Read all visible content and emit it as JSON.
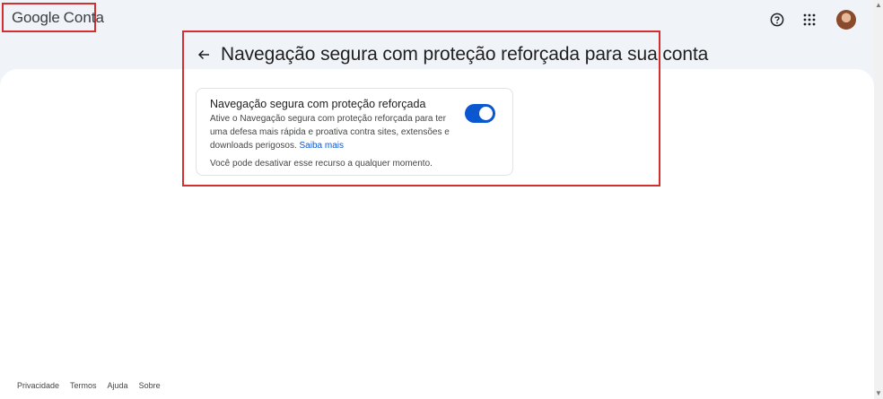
{
  "brand": {
    "google": "Google",
    "product": "Conta"
  },
  "header": {
    "icons": [
      "help-icon",
      "apps-grid-icon",
      "avatar"
    ]
  },
  "page": {
    "title": "Navegação segura com proteção reforçada para sua conta"
  },
  "card": {
    "title": "Navegação segura com proteção reforçada",
    "description": "Ative o Navegação segura com proteção reforçada para ter uma defesa mais rápida e proativa contra sites, extensões e downloads perigosos.",
    "link_label": "Saiba mais",
    "note": "Você pode desativar esse recurso a qualquer momento.",
    "toggle_on": true
  },
  "footer": {
    "links": [
      "Privacidade",
      "Termos",
      "Ajuda",
      "Sobre"
    ]
  },
  "colors": {
    "accent": "#0b57d0",
    "highlight_border": "#d32f2f",
    "background": "#f0f4f9"
  }
}
